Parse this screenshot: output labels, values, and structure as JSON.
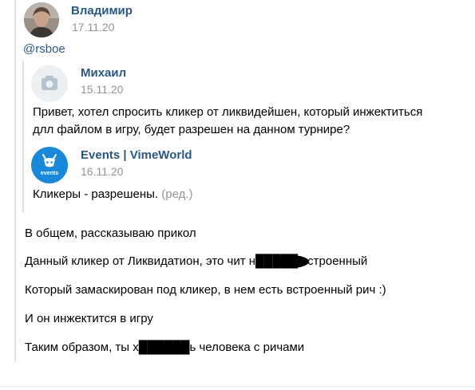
{
  "post": {
    "author": "Владимир",
    "date": "17.11.20",
    "mention": "@rsboe",
    "quote": {
      "author": "Михаил",
      "date": "15.11.20",
      "text_line1": "Привет, хотел спросить кликер от ликвидейшен, который инжектиться",
      "text_line2": "длл файлом в игру, будет разрешен на данном турнире?"
    },
    "reply": {
      "author": "Events | VimeWorld",
      "date": "16.11.20",
      "text": "Кликеры - разрешены.",
      "edited": "(ред.)"
    },
    "lines": [
      "В общем, рассказываю прикол",
      "Данный кликер от Ликвидатион, это чит н█████ встроенный",
      "Который замаскирован под кликер, в нем есть встроенный рич :)",
      "И он инжектится в игру",
      "Таким образом, ты х██████ь человека с ричами"
    ],
    "events_logo_text": "events"
  },
  "colors": {
    "link": "#2a5885",
    "muted": "#939393",
    "bar": "#dce1e6",
    "events_bg": "#1a88d8"
  },
  "icons": [
    "camera-icon",
    "events-logo-icon"
  ]
}
